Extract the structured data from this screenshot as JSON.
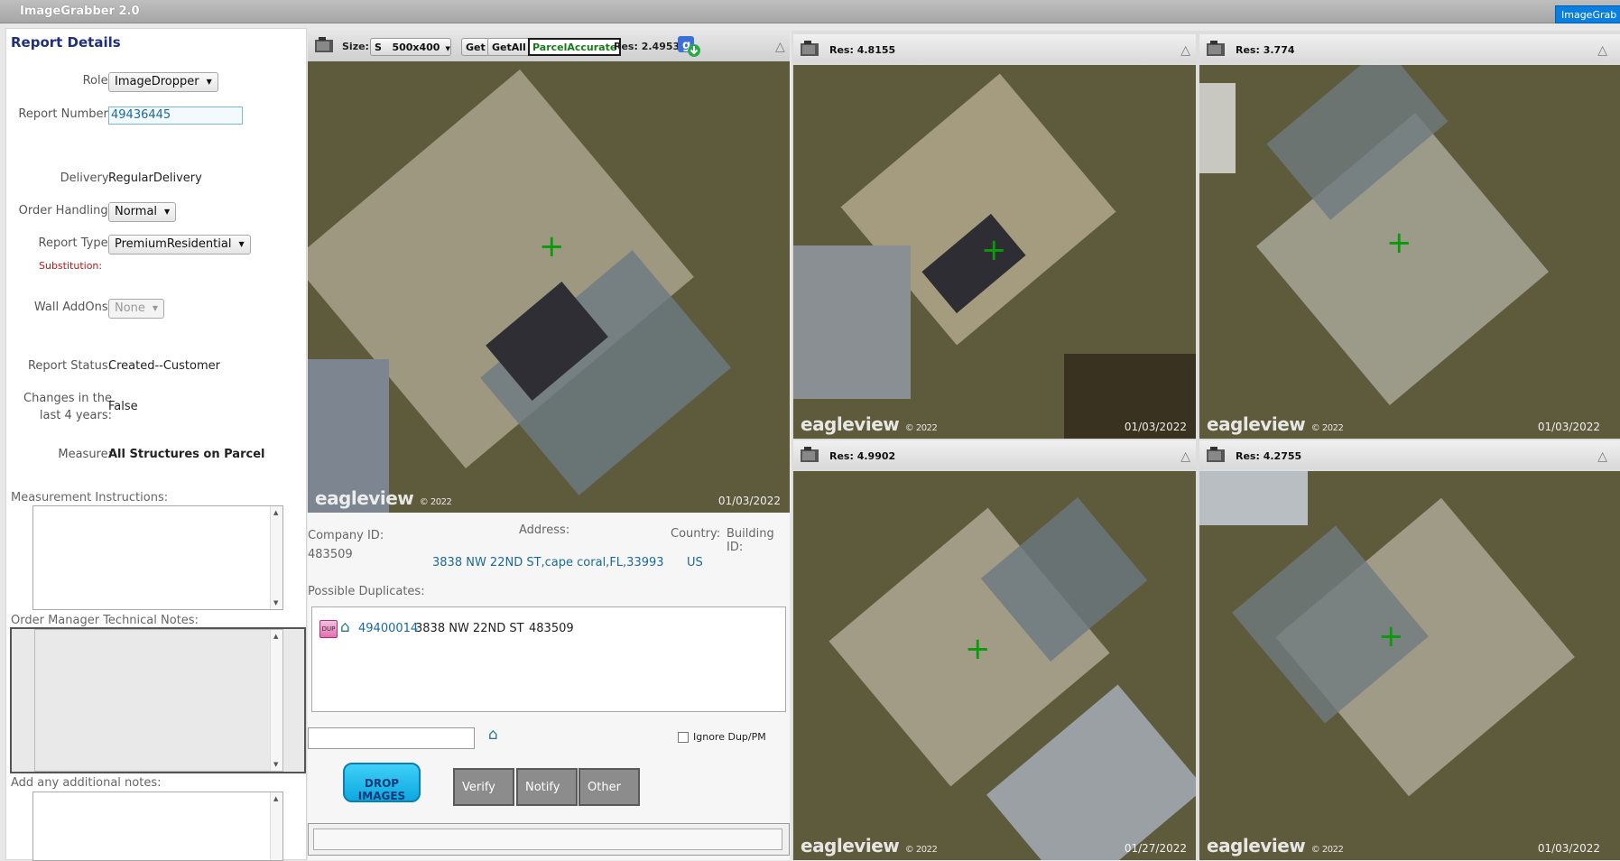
{
  "app": {
    "title": "ImageGrabber 2.0",
    "tab": "ImageGrab"
  },
  "report": {
    "heading": "Report Details",
    "role_label": "Role:",
    "role": "ImageDropper",
    "report_number_label": "Report Number:",
    "report_number": "49436445",
    "delivery_label": "Delivery:",
    "delivery": "RegularDelivery",
    "order_handling_label": "Order Handling:",
    "order_handling": "Normal",
    "report_type_label": "Report Type:",
    "report_type": "PremiumResidential",
    "substitution_label": "Substitution:",
    "wall_addons_label": "Wall AddOns:",
    "wall_addons": "None",
    "report_status_label": "Report Status:",
    "report_status": "Created--Customer",
    "changes_label_1": "Changes in the",
    "changes_label_2": "last 4 years:",
    "changes": "False",
    "measure_label": "Measure:",
    "measure": "All Structures on Parcel",
    "measurement_instructions_label": "Measurement Instructions:",
    "order_manager_notes_label": "Order Manager Technical Notes:",
    "additional_notes_label": "Add any additional notes:"
  },
  "toolbar": {
    "size_label": "Size:",
    "size_code": "S",
    "size_value": "500x400",
    "get_label": "Get",
    "getall_label": "GetAll",
    "parcel_accurate_label": "ParcelAccurate",
    "res_label": "Res: 2.4953"
  },
  "main_image": {
    "watermark": "eagleview",
    "copyright": "© 2022",
    "date": "01/03/2022"
  },
  "details": {
    "company_id_label": "Company ID:",
    "company_id": "483509",
    "address_label": "Address:",
    "address": "3838 NW 22ND ST,cape coral,FL,33993",
    "country_label": "Country:",
    "country": "US",
    "building_id_label": "Building ID:"
  },
  "duplicates": {
    "label": "Possible Duplicates:",
    "icon_text": "DUP",
    "items": [
      {
        "report": "49400014",
        "address": "3838 NW 22ND ST",
        "company": "483509"
      }
    ]
  },
  "actions": {
    "ignore_label": "Ignore Dup/PM",
    "drop_images": "DROP IMAGES",
    "verify": "Verify",
    "notify": "Notify",
    "other": "Other"
  },
  "thumbs": [
    {
      "res": "Res: 4.8155",
      "date": "01/03/2022",
      "copyright": "© 2022",
      "watermark": "eagleview"
    },
    {
      "res": "Res: 3.774",
      "date": "01/03/2022",
      "copyright": "© 2022",
      "watermark": "eagleview"
    },
    {
      "res": "Res: 4.9902",
      "date": "01/27/2022",
      "copyright": "© 2022",
      "watermark": "eagleview"
    },
    {
      "res": "Res: 4.2755",
      "date": "01/03/2022",
      "copyright": "© 2022",
      "watermark": "eagleview"
    }
  ]
}
